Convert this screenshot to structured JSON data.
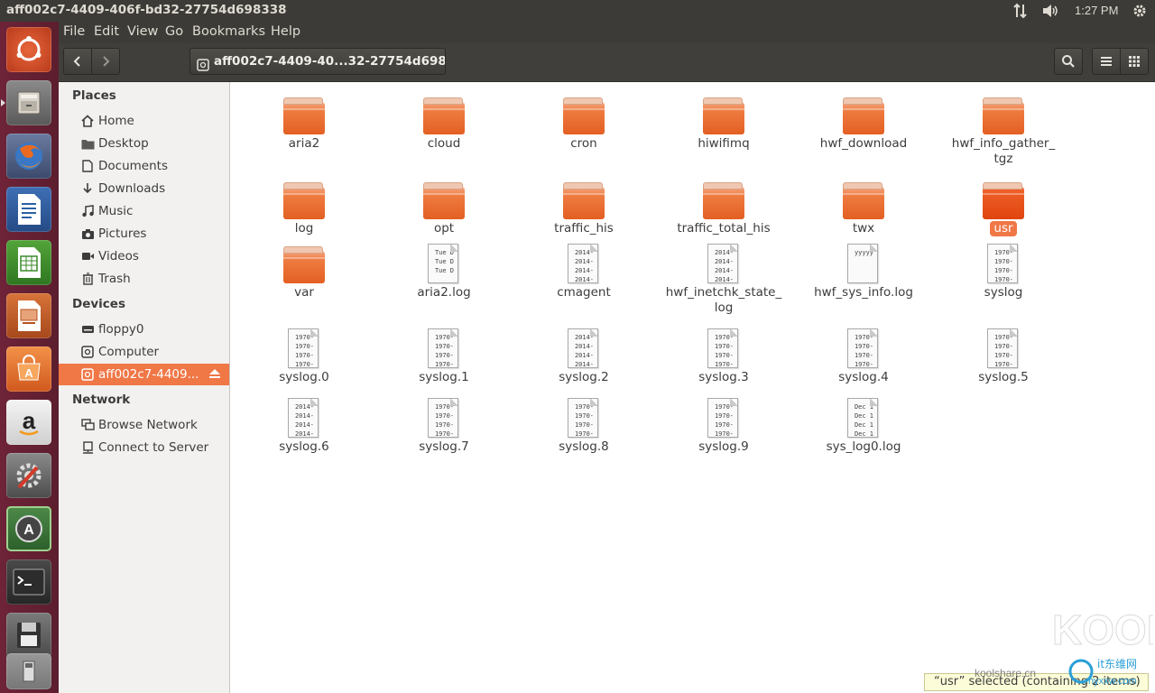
{
  "window": {
    "title": "aff002c7-4409-406f-bd32-27754d698338"
  },
  "top_panel": {
    "time": "1:27 PM"
  },
  "menubar": [
    "File",
    "Edit",
    "View",
    "Go",
    "Bookmarks",
    "Help"
  ],
  "toolbar": {
    "path_label": "aff002c7-4409-40...32-27754d698338"
  },
  "sidebar": {
    "places_header": "Places",
    "places": [
      "Home",
      "Desktop",
      "Documents",
      "Downloads",
      "Music",
      "Pictures",
      "Videos",
      "Trash"
    ],
    "devices_header": "Devices",
    "devices": [
      "floppy0",
      "Computer",
      "aff002c7-4409..."
    ],
    "network_header": "Network",
    "network": [
      "Browse Network",
      "Connect to Server"
    ]
  },
  "files": [
    {
      "name": "aria2",
      "type": "folder"
    },
    {
      "name": "cloud",
      "type": "folder"
    },
    {
      "name": "cron",
      "type": "folder"
    },
    {
      "name": "hiwifimq",
      "type": "folder"
    },
    {
      "name": "hwf_download",
      "type": "folder"
    },
    {
      "name": "hwf_info_gather_\ntgz",
      "type": "folder"
    },
    {
      "name": "log",
      "type": "folder"
    },
    {
      "name": "opt",
      "type": "folder"
    },
    {
      "name": "traffic_his",
      "type": "folder"
    },
    {
      "name": "traffic_total_his",
      "type": "folder"
    },
    {
      "name": "twx",
      "type": "folder"
    },
    {
      "name": "usr",
      "type": "folder",
      "selected": true
    },
    {
      "name": "var",
      "type": "folder"
    },
    {
      "name": "aria2.log",
      "type": "text",
      "preview": "Tue D\nTue D\nTue D"
    },
    {
      "name": "cmagent",
      "type": "text",
      "preview": "2014-\n2014-\n2014-\n2014-"
    },
    {
      "name": "hwf_inetchk_state_\nlog",
      "type": "text",
      "preview": "2014-\n2014-\n2014-\n2014-"
    },
    {
      "name": "hwf_sys_info.log",
      "type": "text",
      "preview": "yyyyy"
    },
    {
      "name": "syslog",
      "type": "text",
      "preview": "1970-\n1970-\n1970-\n1970-"
    },
    {
      "name": "syslog.0",
      "type": "text",
      "preview": "1970-\n1970-\n1970-\n1970-"
    },
    {
      "name": "syslog.1",
      "type": "text",
      "preview": "1970-\n1970-\n1970-\n1970-"
    },
    {
      "name": "syslog.2",
      "type": "text",
      "preview": "2014-\n2014-\n2014-\n2014-"
    },
    {
      "name": "syslog.3",
      "type": "text",
      "preview": "1970-\n1970-\n1970-\n1970-"
    },
    {
      "name": "syslog.4",
      "type": "text",
      "preview": "1970-\n1970-\n1970-\n1970-"
    },
    {
      "name": "syslog.5",
      "type": "text",
      "preview": "1970-\n1970-\n1970-\n1970-"
    },
    {
      "name": "syslog.6",
      "type": "text",
      "preview": "2014-\n2014-\n2014-\n2014-"
    },
    {
      "name": "syslog.7",
      "type": "text",
      "preview": "1970-\n1970-\n1970-\n1970-"
    },
    {
      "name": "syslog.8",
      "type": "text",
      "preview": "1970-\n1970-\n1970-\n1970-"
    },
    {
      "name": "syslog.9",
      "type": "text",
      "preview": "1970-\n1970-\n1970-\n1970-"
    },
    {
      "name": "sys_log0.log",
      "type": "text",
      "preview": "Dec 1\nDec 1\nDec 1\nDec 1"
    }
  ],
  "status": {
    "text": "“usr” selected  (containing 2 items)"
  },
  "watermark": {
    "text": "KOOL",
    "site": "koolshare.cn",
    "site2": "it东维网",
    "url": "hyxxw.com"
  },
  "colors": {
    "accent": "#f07746",
    "launcher": "#5f1f31",
    "panel": "#3c3b37"
  }
}
